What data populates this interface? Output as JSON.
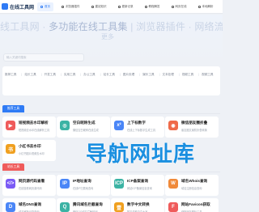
{
  "header": {
    "logo_text": "在线工具网",
    "nav": [
      {
        "label": "首页",
        "active": true
      },
      {
        "label": "浏览器插件",
        "active": false
      },
      {
        "label": "建站知识",
        "active": false
      },
      {
        "label": "更新记录",
        "active": false
      },
      {
        "label": "教程解答",
        "active": false
      },
      {
        "label": "网页在线",
        "active": false
      },
      {
        "label": "本地解析",
        "active": false
      }
    ]
  },
  "hero": {
    "title_part1": "线工具网 · ",
    "title_part2": "多功能在线工具集",
    "title_part3": "浏览器插件 · 网络流行热梗",
    "subtitle": "更多",
    "search_placeholder": "输入关键词搜索"
  },
  "categories": [
    "推荐工具",
    "站长工具",
    "开发工具",
    "实用工具",
    "办公工具",
    "站长工具",
    "图片处理",
    "娱乐工具",
    "文本处理",
    "视频工具",
    "视频工具"
  ],
  "sections": [
    {
      "tab": "推荐工具",
      "color": "#2f7bf5",
      "cards": [
        {
          "title": "短视频去水印解析",
          "desc": "短视频去水印在线解析工具",
          "icon": "video-icon",
          "glyph": "▶",
          "color": "#ef5b5b"
        },
        {
          "title": "空白昵称生成",
          "desc": "微信空白昵称在线生成",
          "icon": "blank-name-icon",
          "glyph": "◎",
          "color": "#3bb3a4"
        },
        {
          "title": "上下标数字",
          "desc": "在线上下标数字生成工具",
          "icon": "superscript-icon",
          "glyph": "x²",
          "color": "#4a86f7"
        },
        {
          "title": "微信朋友圈折叠",
          "desc": "朋友圈文案防折叠转换",
          "icon": "wechat-icon",
          "glyph": "◉",
          "color": "#ef6a4a"
        },
        {
          "title": "小红书去水印",
          "desc": "小红书图片视频去水印",
          "icon": "xiaohongshu-icon",
          "glyph": "书",
          "color": "#f0a020"
        }
      ]
    },
    {
      "tab": "站长工具",
      "color": "#ef5b5b",
      "cards": [
        {
          "title": "网页源代码查看",
          "desc": "在线查看网页源代码",
          "icon": "code-icon",
          "glyph": "</>",
          "color": "#7a5af5"
        },
        {
          "title": "IP地址查询",
          "desc": "在线IP归属地查询",
          "icon": "ip-icon",
          "glyph": "IP",
          "color": "#4a86f7"
        },
        {
          "title": "ICP备案查询",
          "desc": "网站ICP备案信息查询",
          "icon": "icp-icon",
          "glyph": "ICP",
          "color": "#3bb3a4"
        },
        {
          "title": "域名Whois查询",
          "desc": "域名注册信息查询",
          "icon": "whois-icon",
          "glyph": "W",
          "color": "#f08a3a"
        },
        {
          "title": "域名DNS查询",
          "desc": "域名解析记录查询",
          "icon": "dns-icon",
          "glyph": "D",
          "color": "#4a86f7"
        },
        {
          "title": "腾讯域名拦截查询",
          "desc": "微信QQ域名拦截检测",
          "icon": "tencent-icon",
          "glyph": "Q",
          "color": "#3bb3a4"
        },
        {
          "title": "数字中文转换",
          "desc": "数字金额中文大写",
          "icon": "number-icon",
          "glyph": "壹",
          "color": "#f0a020"
        },
        {
          "title": "网站Favicon获取",
          "desc": "获取网站图标工具",
          "icon": "favicon-icon",
          "glyph": "F",
          "color": "#ef5b5b"
        }
      ]
    }
  ],
  "watermark": "导航网址库"
}
